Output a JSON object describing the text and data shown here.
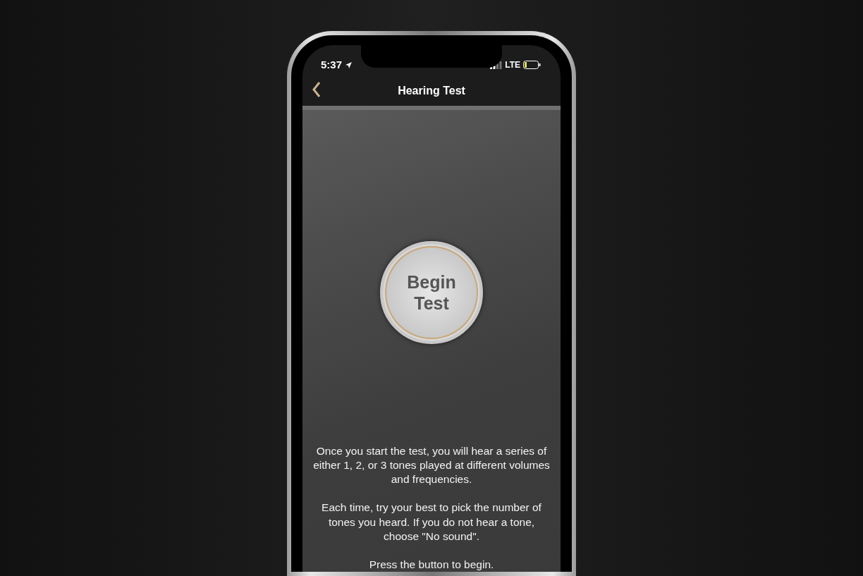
{
  "status_bar": {
    "time": "5:37",
    "network": "LTE"
  },
  "nav": {
    "title": "Hearing Test"
  },
  "begin_button": {
    "label": "Begin Test"
  },
  "paragraphs": [
    "Once you start the test, you will hear a series of either 1, 2, or 3 tones played at different volumes and frequencies.",
    "Each time, try your best to pick the number of tones you heard. If you do not hear a tone, choose \"No sound\".",
    "Press the button to begin."
  ]
}
